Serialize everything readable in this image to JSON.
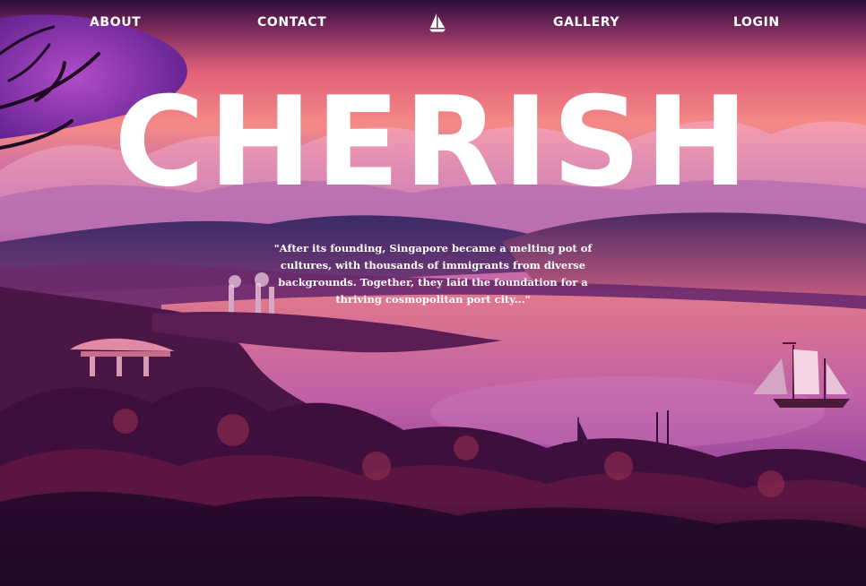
{
  "nav": {
    "about": "ABOUT",
    "contact": "CONTACT",
    "gallery": "GALLERY",
    "login": "LOGIN",
    "logo_icon": "sailboat-icon"
  },
  "hero": {
    "title": "CHERISH",
    "quote": "\"After its founding, Singapore became a melting pot of cultures, with thousands of immigrants from diverse backgrounds. Together, they laid the foundation for a thriving cosmopolitan port city...\""
  },
  "colors": {
    "sky_top": "#3a1240",
    "sky_glow": "#f0727c",
    "water": "#b85aa8",
    "foliage": "#3a0e3a",
    "text": "#ffffff"
  }
}
